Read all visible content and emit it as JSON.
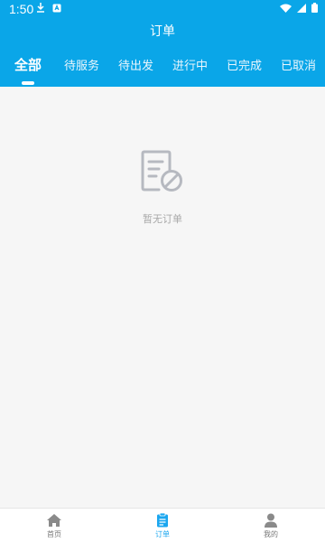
{
  "status_bar": {
    "time": "1:50"
  },
  "header": {
    "title": "订单"
  },
  "tabs": [
    {
      "label": "全部",
      "active": true
    },
    {
      "label": "待服务",
      "active": false
    },
    {
      "label": "待出发",
      "active": false
    },
    {
      "label": "进行中",
      "active": false
    },
    {
      "label": "已完成",
      "active": false
    },
    {
      "label": "已取消",
      "active": false
    }
  ],
  "empty_state": {
    "icon": "document-blocked-icon",
    "text": "暂无订单"
  },
  "bottom_nav": [
    {
      "label": "首页",
      "icon": "home-icon",
      "active": false
    },
    {
      "label": "订单",
      "icon": "clipboard-icon",
      "active": true
    },
    {
      "label": "我的",
      "icon": "person-icon",
      "active": false
    }
  ],
  "colors": {
    "primary": "#0aa6e8",
    "nav_active": "#1aa6ef",
    "background": "#f6f6f6"
  }
}
